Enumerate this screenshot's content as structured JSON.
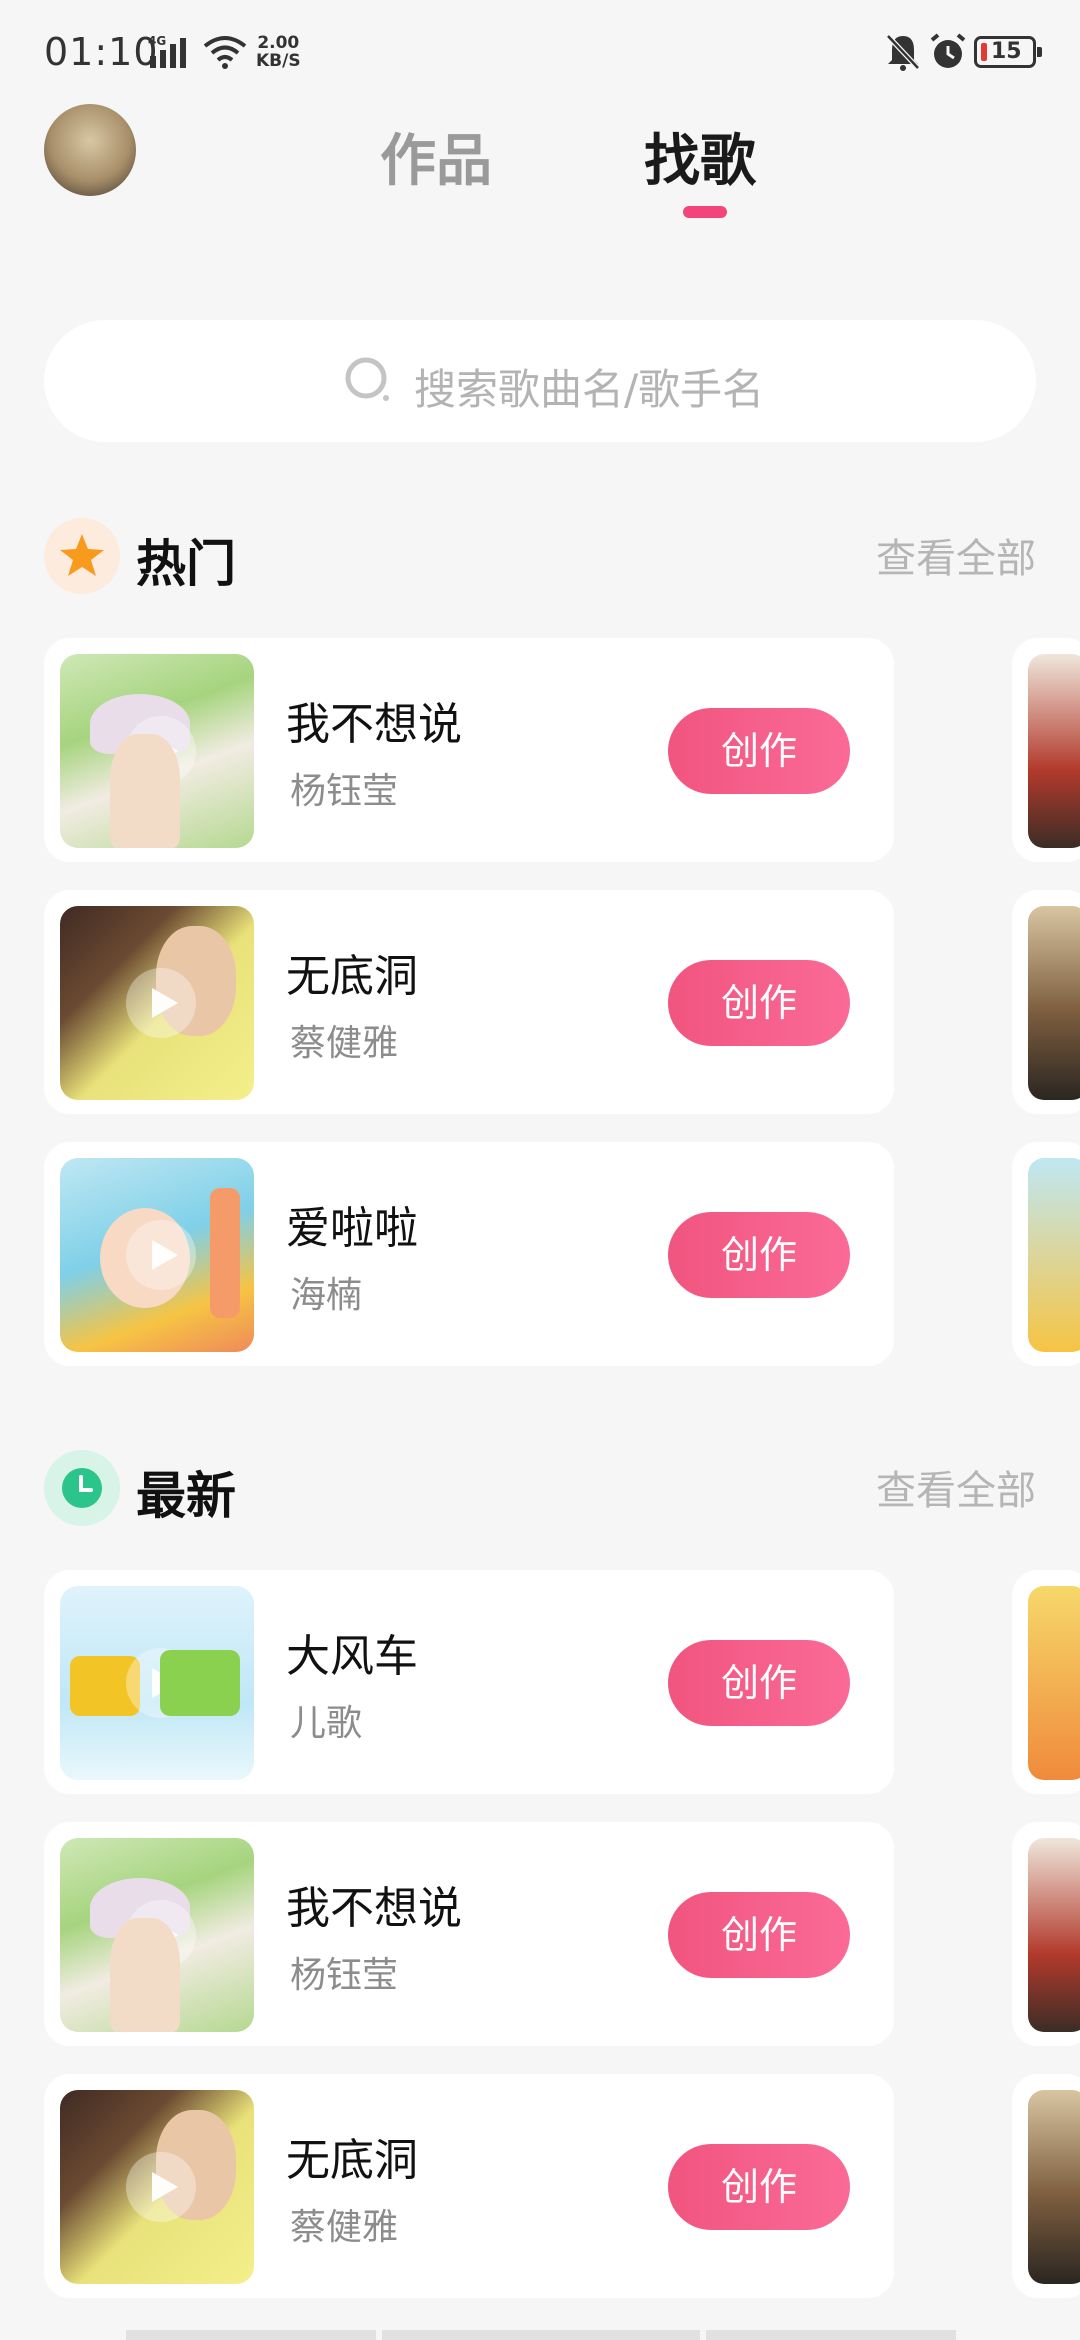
{
  "status_bar": {
    "time": "01:10",
    "network": "4G",
    "speed_value": "2.00",
    "speed_unit": "KB/S",
    "battery": "15"
  },
  "header": {
    "tabs": [
      {
        "label": "作品",
        "active": false
      },
      {
        "label": "找歌",
        "active": true
      }
    ],
    "accent_color": "#f2457a"
  },
  "search": {
    "placeholder": "搜索歌曲名/歌手名"
  },
  "sections": {
    "hot": {
      "title": "热门",
      "more": "查看全部",
      "icon": "star-icon",
      "items": [
        {
          "title": "我不想说",
          "artist": "杨钰莹",
          "action": "创作"
        },
        {
          "title": "无底洞",
          "artist": "蔡健雅",
          "action": "创作"
        },
        {
          "title": "爱啦啦",
          "artist": "海楠",
          "action": "创作"
        }
      ]
    },
    "latest": {
      "title": "最新",
      "more": "查看全部",
      "icon": "clock-icon",
      "items": [
        {
          "title": "大风车",
          "artist": "儿歌",
          "action": "创作"
        },
        {
          "title": "我不想说",
          "artist": "杨钰莹",
          "action": "创作"
        },
        {
          "title": "无底洞",
          "artist": "蔡健雅",
          "action": "创作"
        }
      ]
    }
  },
  "colors": {
    "hot_icon_bg": "#fdebdd",
    "hot_icon_fg": "#f89a1c",
    "latest_icon_bg": "#d8f3e7",
    "latest_icon_fg": "#2bc48a",
    "button_gradient_start": "#f0557f",
    "button_gradient_end": "#fb6a97"
  }
}
